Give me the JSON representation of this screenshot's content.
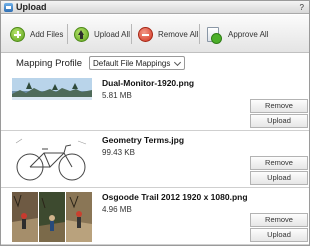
{
  "window": {
    "title": "Upload",
    "help_label": "?"
  },
  "toolbar": {
    "add_files_label": "Add Files",
    "upload_all_label": "Upload All",
    "remove_all_label": "Remove All",
    "approve_all_label": "Approve All"
  },
  "mapping": {
    "label": "Mapping Profile",
    "selected": "Default File Mappings"
  },
  "files": [
    {
      "name": "Dual-Monitor-1920.png",
      "size": "5.81 MB",
      "remove_label": "Remove",
      "upload_label": "Upload"
    },
    {
      "name": "Geometry Terms.jpg",
      "size": "99.43 KB",
      "remove_label": "Remove",
      "upload_label": "Upload"
    },
    {
      "name": "Osgoode Trail 2012 1920 x 1080.png",
      "size": "4.96 MB",
      "remove_label": "Remove",
      "upload_label": "Upload"
    }
  ]
}
